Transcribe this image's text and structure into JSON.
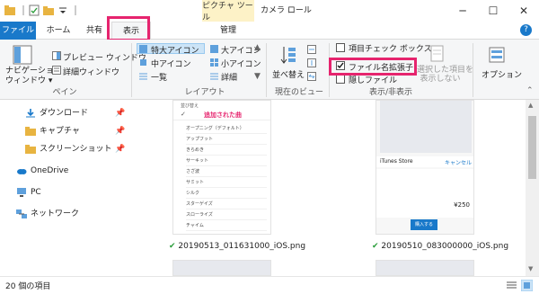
{
  "window": {
    "title": "カメラ ロール",
    "contextual_tab": "ピクチャ ツール",
    "minimize": "─",
    "maximize": "☐",
    "close": "✕"
  },
  "tabs": [
    {
      "label": "ファイル"
    },
    {
      "label": "ホーム"
    },
    {
      "label": "共有"
    },
    {
      "label": "表示"
    },
    {
      "label": "管理"
    }
  ],
  "help": "?",
  "ribbon": {
    "pane_group": {
      "nav_pane": "ナビゲーション\nウィンドウ ▾",
      "nav_pane_line1": "ナビゲーション",
      "nav_pane_line2": "ウィンドウ ▾",
      "preview_pane": "プレビュー ウィンドウ",
      "details_pane": "詳細ウィンドウ",
      "label": "ペイン"
    },
    "layout_group": {
      "extra_large_icons": "特大アイコン",
      "large_icons": "大アイコン",
      "medium_icons": "中アイコン",
      "small_icons": "小アイコン",
      "list": "一覧",
      "details": "詳細",
      "label": "レイアウト"
    },
    "current_view_group": {
      "sort_by": "並べ替え",
      "label": "現在のビュー"
    },
    "show_hide_group": {
      "item_checkboxes": "項目チェック ボックス",
      "file_name_extensions": "ファイル名拡張子",
      "hidden_items": "隠しファイル",
      "hide_selected_line1": "選択した項目を",
      "hide_selected_line2": "表示しない",
      "label": "表示/非表示",
      "file_ext_checked": true
    },
    "options": "オプション"
  },
  "nav": [
    {
      "label": "ダウンロード",
      "pinned": true
    },
    {
      "label": "キャプチャ",
      "pinned": true
    },
    {
      "label": "スクリーンショット",
      "pinned": true
    },
    {
      "label": "OneDrive"
    },
    {
      "label": "PC"
    },
    {
      "label": "ネットワーク"
    }
  ],
  "pin_glyph": "📌",
  "files": [
    {
      "name": "20190513_011631000_iOS.png",
      "status": "✔",
      "preview": {
        "header": "並び替え",
        "highlight": "追加された曲",
        "rows": [
          "オープニング（デフォルト）",
          "アップフット",
          "きらめき",
          "サーキット",
          "さざ波",
          "サミット",
          "シルク",
          "スターゲイズ",
          "スローライズ",
          "チャイム"
        ]
      }
    },
    {
      "name": "20190510_083000000_iOS.png",
      "status": "✔",
      "preview": {
        "store": "iTunes Store",
        "cancel": "キャンセル",
        "price": "¥250",
        "buy": "購入する"
      }
    }
  ],
  "status_bar": {
    "count": "20 個の項目"
  },
  "colors": {
    "accent": "#1979ca",
    "highlight": "#e6246e",
    "contextual": "#fdf2c7"
  }
}
